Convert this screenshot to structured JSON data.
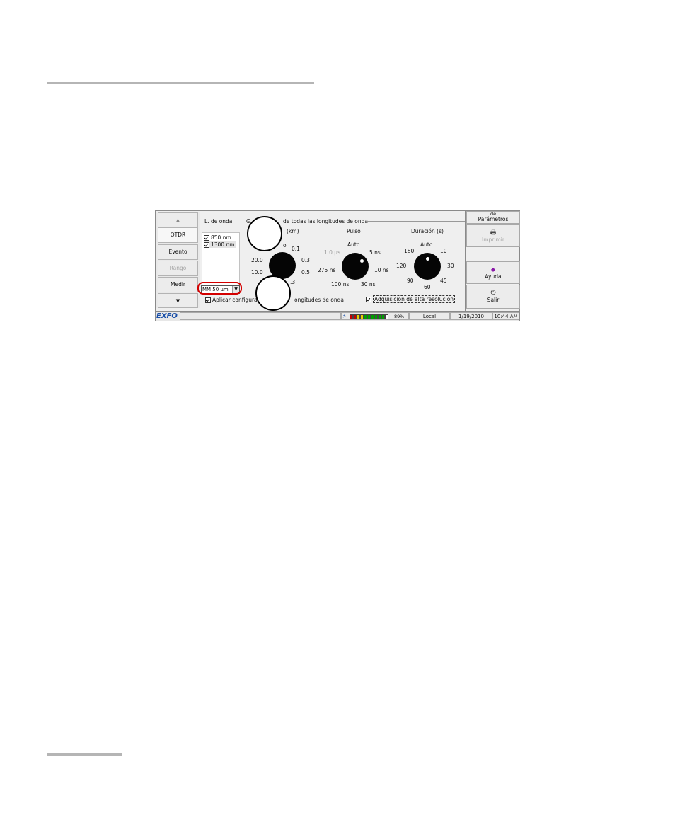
{
  "nav": {
    "up": "▲",
    "items": [
      {
        "label": "OTDR"
      },
      {
        "label": "Evento"
      },
      {
        "label": "Rango"
      },
      {
        "label": "Medir"
      }
    ],
    "down": "▼"
  },
  "wavelength": {
    "header": "L. de onda",
    "items": [
      "850 nm",
      "1300 nm"
    ],
    "fiber_select": "MM 50 µm"
  },
  "group_title": "Configuración de todas las longitudes de onda",
  "group_title_visible_start": "C",
  "group_title_visible_end": "de todas las longitudes de onda",
  "range": {
    "label_visible": "(km)",
    "ticks_visible": [
      "o",
      "0.1",
      "0.3",
      "0.5",
      ".3",
      "20.0",
      "10.0"
    ]
  },
  "pulse": {
    "label": "Pulso",
    "ticks": [
      "Auto",
      "5 ns",
      "10 ns",
      "30 ns",
      "100 ns",
      "275 ns",
      "1.0 µs"
    ]
  },
  "duration": {
    "label": "Duración (s)",
    "ticks": [
      "Auto",
      "10",
      "30",
      "45",
      "60",
      "90",
      "120",
      "180"
    ]
  },
  "apply_all_visible_start": "Aplicar configurac",
  "apply_all_visible_end": "ongitudes de onda",
  "high_res": "Adquisición de alta resolución",
  "right_panel": {
    "params_top": "de",
    "params": "Parámetros",
    "print": "Imprimir",
    "help": "Ayuda",
    "exit": "Salir"
  },
  "status": {
    "brand": "EXFO",
    "battery": "89%",
    "mode": "Local",
    "date": "1/19/2010",
    "time": "10:44 AM"
  },
  "colors": {
    "battery_red": "#c40000",
    "battery_yellow": "#e8d000",
    "battery_green": "#00a000",
    "brand_blue": "#1a4fa8",
    "callout_ring": "#d40000"
  }
}
